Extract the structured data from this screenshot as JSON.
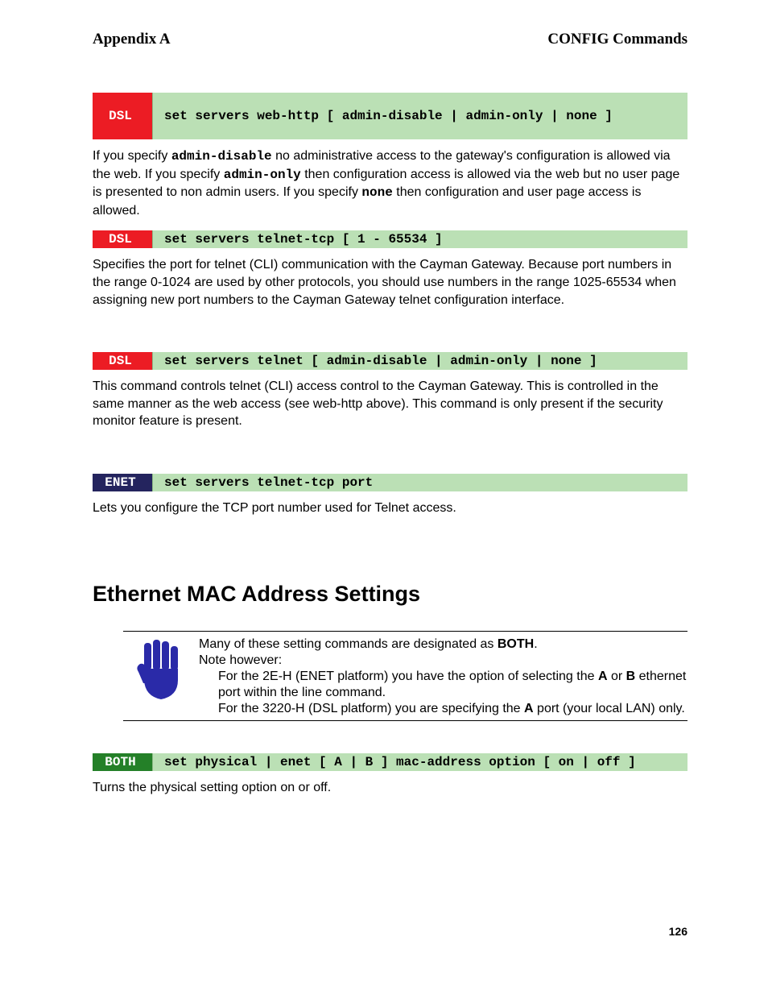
{
  "header": {
    "left": "Appendix A",
    "right": "CONFIG Commands"
  },
  "blocks": [
    {
      "badge": "DSL",
      "badge_class": "red",
      "height": "tall",
      "title": "set servers web-http [ admin-disable | admin-only | none ]",
      "desc_html": "If you specify <span class='mono'>admin-disable</span> no administrative access to the gateway's configuration is allowed via the web. If you specify <span class='mono'>admin-only</span> then configuration access is allowed via the web but no user page is presented to non admin users. If you specify <span class='mono'>none</span> then configuration and user page access is allowed."
    },
    {
      "badge": "DSL",
      "badge_class": "red",
      "height": "short",
      "title": "set servers telnet-tcp [ 1 - 65534 ]",
      "desc_html": "Specifies the port for telnet (CLI) communication with the Cayman Gateway. Because port numbers in the range 0-1024 are used by other protocols, you should use numbers in the range 1025-65534 when assigning new port numbers to the Cayman Gateway telnet configuration interface."
    },
    {
      "badge": "DSL",
      "badge_class": "red",
      "height": "short",
      "title": "set servers telnet [ admin-disable | admin-only | none ]",
      "desc_html": "This command controls telnet (CLI) access control to the Cayman Gateway. This is controlled in the same manner as the web access (see web-http above). This command is only present if the security monitor feature is present."
    },
    {
      "badge": "ENET",
      "badge_class": "navy",
      "height": "short",
      "title": "set servers telnet-tcp port",
      "desc_html": "Lets you configure the TCP port number used for Telnet access."
    }
  ],
  "section_title": "Ethernet MAC Address Settings",
  "note": {
    "line1_prefix": "Many of these setting commands are designated as ",
    "line1_bold": "BOTH",
    "line1_suffix": ".",
    "line2": "Note however:",
    "line3_prefix": "For the 2E-H (ENET platform) you have the option of selecting the ",
    "line3_a": "A",
    "line3_mid": " or ",
    "line3_b": "B",
    "line3_suffix": " ethernet port within the line command.",
    "line4_prefix": "For the 3220-H (DSL platform) you are specifying the ",
    "line4_a": "A",
    "line4_suffix": " port (your local LAN) only."
  },
  "bottom": {
    "badge": "BOTH",
    "badge_class": "green",
    "height": "short",
    "title": "set physical | enet [ A | B ] mac-address option [ on | off ]",
    "desc_html": "Turns the physical setting option on or off."
  },
  "page_number": "126"
}
